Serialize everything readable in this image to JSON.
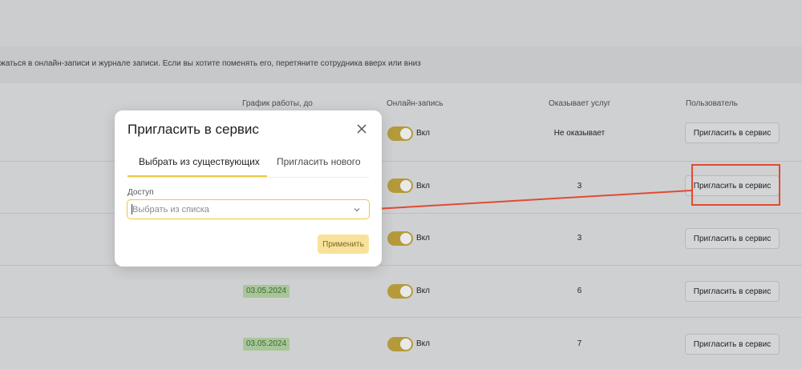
{
  "info_text": "жаться в онлайн-записи и журнале записи. Если вы хотите поменять его, перетяните сотрудника вверх или вниз",
  "table": {
    "headers": {
      "schedule": "График работы, до",
      "online": "Онлайн-запись",
      "services": "Оказывает услуг",
      "user": "Пользователь"
    },
    "rows": [
      {
        "date": "",
        "online": "Вкл",
        "services": "Не оказывает",
        "action": "Пригласить в сервис"
      },
      {
        "date": "",
        "online": "Вкл",
        "services": "3",
        "action": "Пригласить в сервис"
      },
      {
        "date": "",
        "online": "Вкл",
        "services": "3",
        "action": "Пригласить в сервис"
      },
      {
        "date": "03.05.2024",
        "online": "Вкл",
        "services": "6",
        "action": "Пригласить в сервис"
      },
      {
        "date": "03.05.2024",
        "online": "Вкл",
        "services": "7",
        "action": "Пригласить в сервис"
      }
    ]
  },
  "modal": {
    "title": "Пригласить в сервис",
    "tabs": [
      "Выбрать из существующих",
      "Пригласить нового"
    ],
    "active_tab": 0,
    "field_label": "Доступ",
    "select_placeholder": "Выбрать из списка",
    "apply_label": "Применить"
  },
  "colors": {
    "accent": "#f0c63a",
    "toggle_on": "#b49a3a",
    "annotation": "#e24a33"
  },
  "icons": {
    "close": "close-icon",
    "dropdown": "chevron-down-icon"
  }
}
